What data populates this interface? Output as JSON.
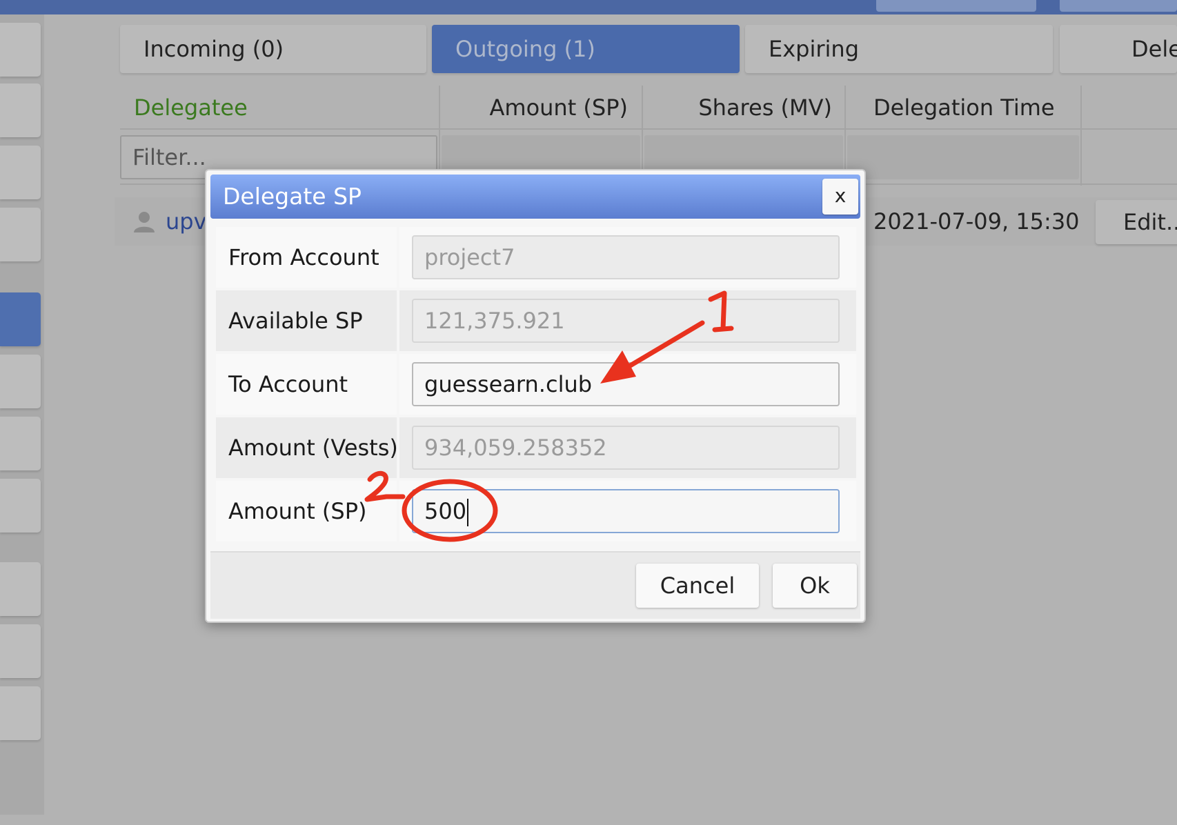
{
  "tabs": [
    {
      "label": "Incoming (0)"
    },
    {
      "label": "Outgoing (1)"
    },
    {
      "label": "Expiring"
    },
    {
      "label": "Dele"
    }
  ],
  "table": {
    "headers": [
      "Delegatee",
      "Amount (SP)",
      "Shares (MV)",
      "Delegation Time"
    ],
    "filter_placeholder": "Filter...",
    "row": {
      "delegatee": "upv",
      "time": "2021-07-09, 15:30",
      "action": "Edit..."
    }
  },
  "dialog": {
    "title": "Delegate SP",
    "close_label": "x",
    "fields": [
      {
        "label": "From Account",
        "value": "project7"
      },
      {
        "label": "Available SP",
        "value": "121,375.921"
      },
      {
        "label": "To Account",
        "value": "guessearn.club"
      },
      {
        "label": "Amount (Vests)",
        "value": "934,059.258352"
      },
      {
        "label": "Amount (SP)",
        "value": "500"
      }
    ],
    "cancel_label": "Cancel",
    "ok_label": "Ok"
  },
  "annotations": {
    "marker_1": "1",
    "marker_2": "2",
    "color": "#e8321e"
  },
  "icons": {
    "user": "user-icon",
    "close": "close-icon"
  },
  "colors": {
    "accent": "#4a6aab",
    "header_green": "#3b7a1f",
    "title_gradient_top": "#8aaef5"
  }
}
